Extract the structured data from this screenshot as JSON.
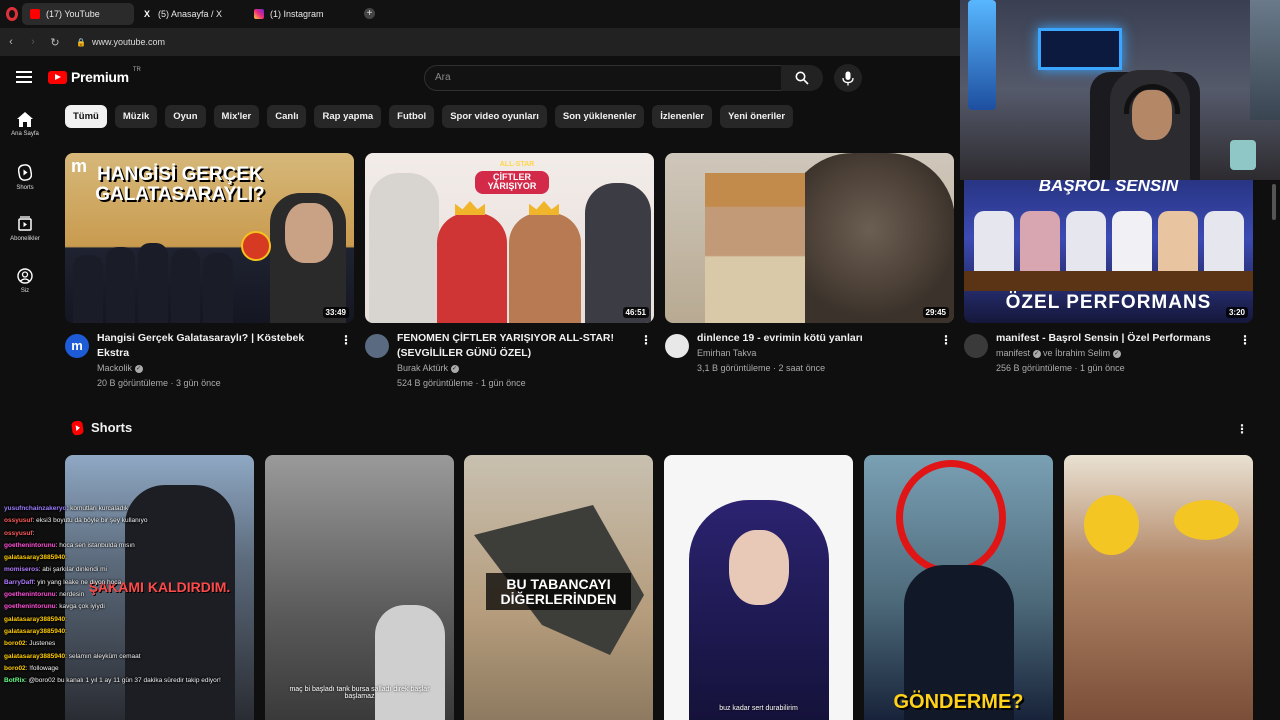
{
  "browser": {
    "tabs": [
      {
        "label": "(17) YouTube",
        "icon": "youtube-icon"
      },
      {
        "label": "(5) Anasayfa / X",
        "icon": "x-icon"
      },
      {
        "label": "(1) Instagram",
        "icon": "instagram-icon"
      }
    ],
    "new_tab": "+",
    "url": "www.youtube.com"
  },
  "header": {
    "brand": "Premium",
    "trademark": "TR",
    "search_placeholder": "Ara"
  },
  "sidebar": {
    "items": [
      {
        "label": "Ana Sayfa",
        "icon": "home-icon"
      },
      {
        "label": "Shorts",
        "icon": "shorts-icon"
      },
      {
        "label": "Abonelikler",
        "icon": "subscriptions-icon"
      },
      {
        "label": "Siz",
        "icon": "you-icon"
      }
    ]
  },
  "chips": [
    "Tümü",
    "Müzik",
    "Oyun",
    "Mix'ler",
    "Canlı",
    "Rap yapma",
    "Futbol",
    "Spor video oyunları",
    "Son yüklenenler",
    "İzlenenler",
    "Yeni öneriler"
  ],
  "videos": [
    {
      "title": "Hangisi Gerçek Galatasaraylı? | Köstebek Ekstra",
      "channel": "Mackolik",
      "stats": "20 B görüntüleme · 3 gün önce",
      "duration": "33:49",
      "thumb_text": "HANGİSİ GERÇEK GALATASARAYLI?",
      "thumb_badge": "m"
    },
    {
      "title": "FENOMEN ÇİFTLER YARIŞIYOR ALL-STAR! (SEVGİLİLER GÜNÜ ÖZEL)",
      "channel": "Burak Aktürk",
      "stats": "524 B görüntüleme · 1 gün önce",
      "duration": "46:51",
      "thumb_text": "ÇİFTLER YARIŞIYOR",
      "thumb_badge": "ALL-STAR"
    },
    {
      "title": "dinlence 19 - evrimin kötü yanları",
      "channel": "Emirhan Takva",
      "stats": "3,1 B görüntüleme · 2 saat önce",
      "duration": "29:45"
    },
    {
      "title": "manifest - Başrol Sensin | Özel Performans",
      "channel": "manifest",
      "channel_extra": "ve İbrahim Selim",
      "stats": "256 B görüntüleme · 1 gün önce",
      "duration": "3:20",
      "thumb_text_top": "BAŞROL SENSİN",
      "thumb_text_bottom": "ÖZEL PERFORMANS"
    }
  ],
  "shorts": {
    "title": "Shorts",
    "items": [
      {
        "overlay": "ŞAKAMI KALDIRDIM."
      },
      {
        "caption": "maç bi başladı tank bursa salladı direk başlar başlamaz"
      },
      {
        "overlay": "BU TABANCAYI DİĞERLERİNDEN"
      },
      {
        "caption": "buz kadar sert durabilirim"
      },
      {
        "overlay": "GÖNDERME?"
      },
      {
        "overlay": ""
      }
    ]
  },
  "chat": [
    {
      "user": "yusufnchainzakeryo",
      "msg": ": komutları kurcaladık",
      "color": "#9b7bff"
    },
    {
      "user": "ossyusuf",
      "msg": ": eksi3 boyutu da böyle bir şey kullanıyo",
      "color": "#ff5b5b"
    },
    {
      "user": "ossyusuf",
      "msg": ":",
      "color": "#ff5b5b"
    },
    {
      "user": "goethenintorunu",
      "msg": ": hoca sen istanbulda mısın",
      "color": "#ff4fd8"
    },
    {
      "user": "galatasaray3885940",
      "msg": ":",
      "color": "#ffcc00"
    },
    {
      "user": "momiseros",
      "msg": ": abi şarkılar dinlendi mi",
      "color": "#b07bff"
    },
    {
      "user": "BarryDaff",
      "msg": ": yin yang leake ne diyon hoca",
      "color": "#b07bff"
    },
    {
      "user": "goethenintorunu",
      "msg": ": nerdesin",
      "color": "#ff4fd8"
    },
    {
      "user": "goethenintorunu",
      "msg": ": kavga çok iyiydi",
      "color": "#ff4fd8"
    },
    {
      "user": "galatasaray3885940",
      "msg": ":",
      "color": "#ffcc00"
    },
    {
      "user": "galatasaray3885940",
      "msg": ":",
      "color": "#ffcc00"
    },
    {
      "user": "boro02",
      "msg": ": Justenes",
      "color": "#ffcc00"
    },
    {
      "user": "galatasaray3885940",
      "msg": ": selamın aleyküm cemaat",
      "color": "#ffcc00"
    },
    {
      "user": "boro02",
      "msg": ": !followage",
      "color": "#ffcc00"
    },
    {
      "user": "BotRix",
      "msg": ": @boro02 bu kanalı 1 yıl 1 ay 11 gün 37 dakika süredir takip ediyor!",
      "color": "#66ff88"
    }
  ]
}
